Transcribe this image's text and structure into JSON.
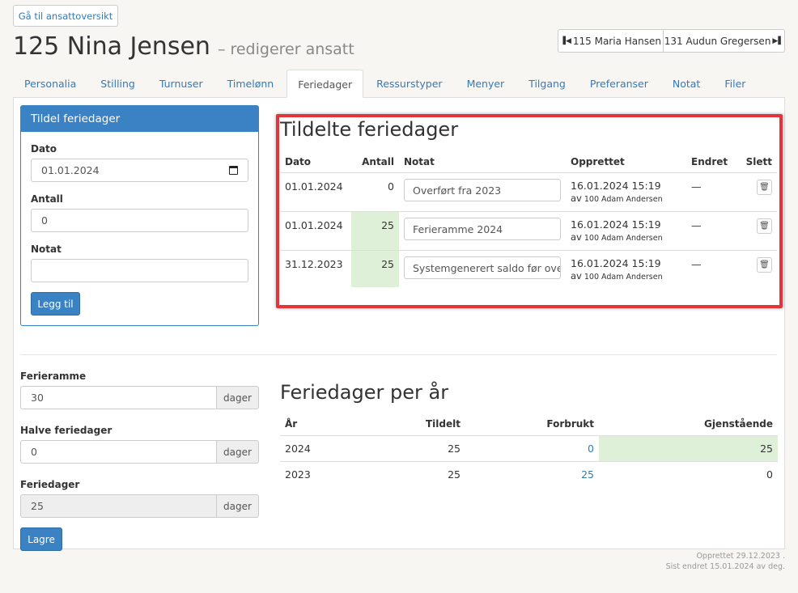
{
  "nav": {
    "back_label": "Gå til ansattoversikt",
    "prev_label": "115 Maria Hansen",
    "next_label": "131 Audun Gregersen"
  },
  "header": {
    "title": "125 Nina Jensen",
    "subtitle": "– redigerer ansatt"
  },
  "tabs": [
    {
      "label": "Personalia"
    },
    {
      "label": "Stilling"
    },
    {
      "label": "Turnuser"
    },
    {
      "label": "Timelønn"
    },
    {
      "label": "Feriedager"
    },
    {
      "label": "Ressurstyper"
    },
    {
      "label": "Menyer"
    },
    {
      "label": "Tilgang"
    },
    {
      "label": "Preferanser"
    },
    {
      "label": "Notat"
    },
    {
      "label": "Filer"
    }
  ],
  "active_tab": "Feriedager",
  "assign_form": {
    "heading": "Tildel feriedager",
    "date_label": "Dato",
    "date_value": "01.01.2024",
    "count_label": "Antall",
    "count_value": "0",
    "note_label": "Notat",
    "note_value": "",
    "submit_label": "Legg til"
  },
  "assigned": {
    "heading": "Tildelte feriedager",
    "columns": [
      "Dato",
      "Antall",
      "Notat",
      "Opprettet",
      "Endret",
      "Slett"
    ],
    "rows": [
      {
        "date": "01.01.2024",
        "count": "0",
        "note": "Overført fra 2023",
        "created": "16.01.2024 15:19",
        "by_prefix": "av",
        "by": "100 Adam Andersen",
        "changed": "—",
        "highlight": false
      },
      {
        "date": "01.01.2024",
        "count": "25",
        "note": "Ferieramme 2024",
        "created": "16.01.2024 15:19",
        "by_prefix": "av",
        "by": "100 Adam Andersen",
        "changed": "—",
        "highlight": true
      },
      {
        "date": "31.12.2023",
        "count": "25",
        "note": "Systemgenerert saldo før overføring",
        "created": "16.01.2024 15:19",
        "by_prefix": "av",
        "by": "100 Adam Andersen",
        "changed": "—",
        "highlight": true
      }
    ]
  },
  "settings_form": {
    "frame_label": "Ferieramme",
    "frame_value": "30",
    "half_label": "Halve feriedager",
    "half_value": "0",
    "days_label": "Feriedager",
    "days_value": "25",
    "unit": "dager",
    "save_label": "Lagre"
  },
  "per_year": {
    "heading": "Feriedager per år",
    "columns": [
      "År",
      "Tildelt",
      "Forbrukt",
      "Gjenstående"
    ],
    "rows": [
      {
        "year": "2024",
        "assigned": "25",
        "used": "0",
        "remaining": "25",
        "highlight": true
      },
      {
        "year": "2023",
        "assigned": "25",
        "used": "25",
        "remaining": "0",
        "highlight": false
      }
    ]
  },
  "footer": {
    "created": "Opprettet 29.12.2023 .",
    "changed": "Sist endret 15.01.2024 av deg."
  },
  "colors": {
    "primary": "#3a82c4",
    "link": "#337ab7",
    "highlight": "#dff0d8",
    "annotation": "#e5333b"
  }
}
